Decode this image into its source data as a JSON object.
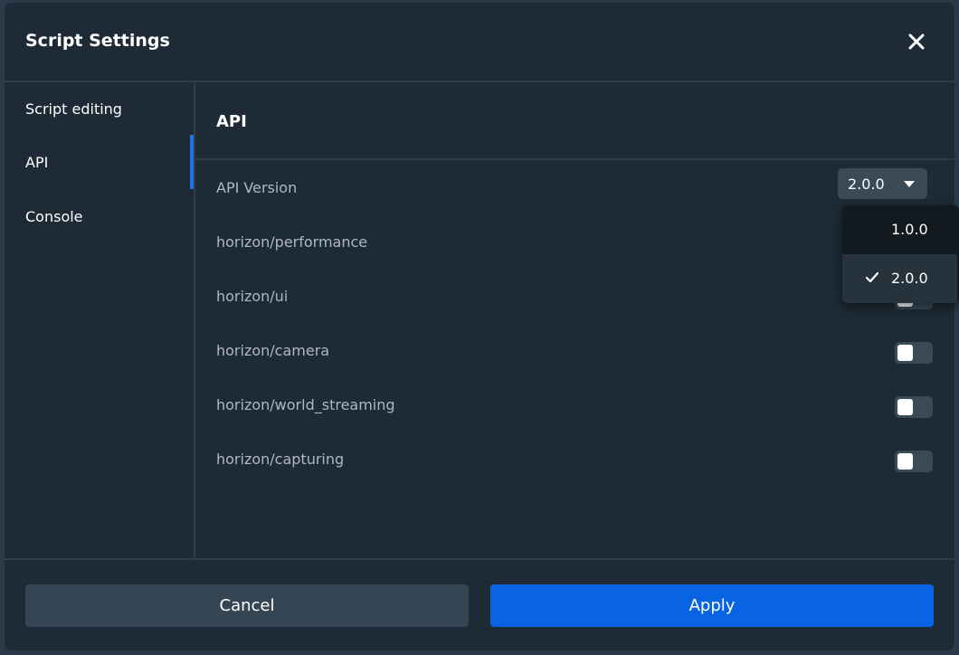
{
  "dialog": {
    "title": "Script Settings",
    "close_icon": "close-icon"
  },
  "sidebar": {
    "items": [
      {
        "label": "Script editing"
      },
      {
        "label": "API",
        "active": true
      },
      {
        "label": "Console"
      }
    ]
  },
  "main": {
    "section_title": "API",
    "api_version": {
      "label": "API Version",
      "selected": "2.0.0",
      "options": [
        {
          "label": "1.0.0",
          "checked": false
        },
        {
          "label": "2.0.0",
          "checked": true
        }
      ]
    },
    "modules": [
      {
        "label": "horizon/performance",
        "enabled": false
      },
      {
        "label": "horizon/ui",
        "enabled": false
      },
      {
        "label": "horizon/camera",
        "enabled": false
      },
      {
        "label": "horizon/world_streaming",
        "enabled": false
      },
      {
        "label": "horizon/capturing",
        "enabled": false
      }
    ]
  },
  "footer": {
    "cancel_label": "Cancel",
    "apply_label": "Apply"
  },
  "colors": {
    "background": "#1e2a35",
    "accent": "#0964e3",
    "secondary_button": "#344653"
  }
}
